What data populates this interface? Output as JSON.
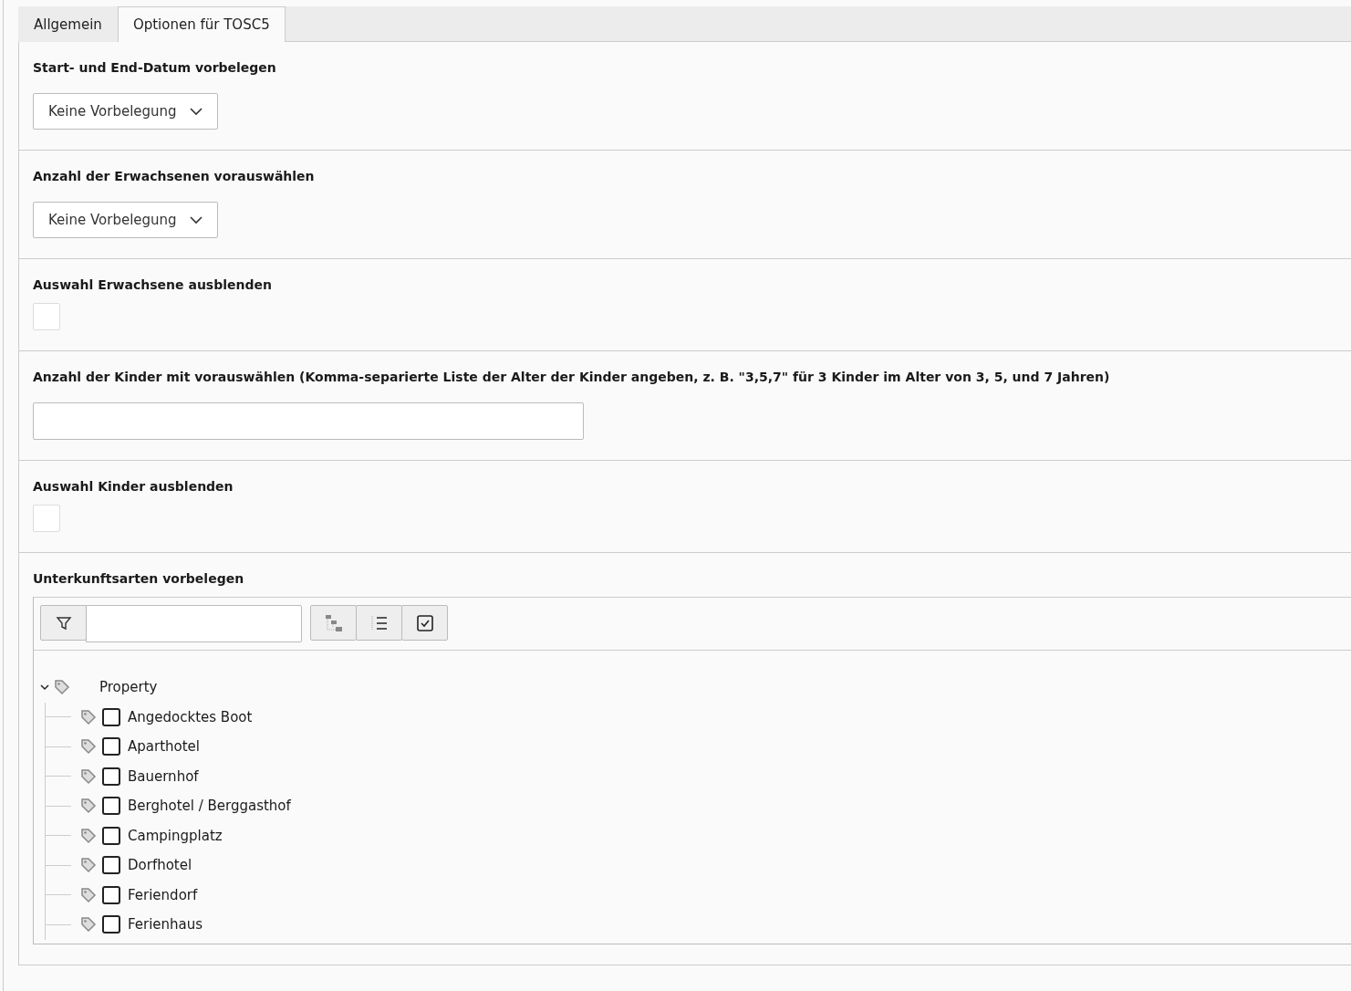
{
  "tabs": [
    {
      "label": "Allgemein",
      "selected": false
    },
    {
      "label": "Optionen für TOSC5",
      "selected": true
    }
  ],
  "sections": [
    {
      "kind": "select",
      "label": "Start- und End-Datum vorbelegen",
      "value": "Keine Vorbelegung"
    },
    {
      "kind": "select",
      "label": "Anzahl der Erwachsenen vorauswählen",
      "value": "Keine Vorbelegung"
    },
    {
      "kind": "checkbox",
      "label": "Auswahl Erwachsene ausblenden",
      "checked": false
    },
    {
      "kind": "text",
      "label": "Anzahl der Kinder mit vorauswählen (Komma-separierte Liste der Alter der Kinder angeben, z. B. \"3,5,7\" für 3 Kinder im Alter von 3, 5, und 7 Jahren)"
    },
    {
      "kind": "checkbox",
      "label": "Auswahl Kinder ausblenden",
      "checked": false
    },
    {
      "kind": "tree",
      "label": "Unterkunftsarten vorbelegen",
      "tree": {
        "label": "Property",
        "expanded": true,
        "children": [
          {
            "label": "Angedocktes Boot",
            "checked": false
          },
          {
            "label": "Aparthotel",
            "checked": false
          },
          {
            "label": "Bauernhof",
            "checked": false
          },
          {
            "label": "Berghotel / Berggasthof",
            "checked": false
          },
          {
            "label": "Campingplatz",
            "checked": false
          },
          {
            "label": "Dorfhotel",
            "checked": false
          },
          {
            "label": "Feriendorf",
            "checked": false
          },
          {
            "label": "Ferienhaus",
            "checked": false
          }
        ]
      }
    }
  ]
}
